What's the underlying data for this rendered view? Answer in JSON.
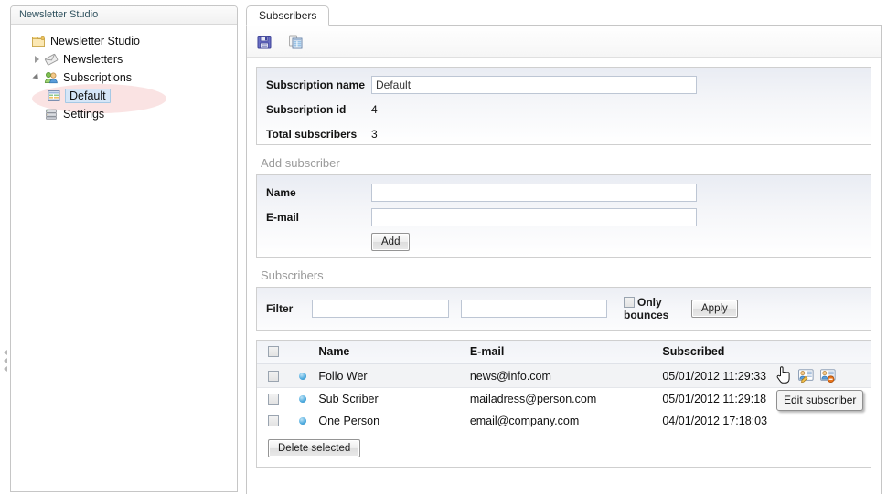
{
  "sidebar": {
    "header": "Newsletter Studio",
    "items": [
      {
        "label": "Newsletter Studio",
        "icon": "folder-icon",
        "level": 1,
        "expander": "none",
        "selected": false
      },
      {
        "label": "Newsletters",
        "icon": "newsletter-icon",
        "level": 2,
        "expander": "collapsed",
        "selected": false
      },
      {
        "label": "Subscriptions",
        "icon": "subscriptions-users-icon",
        "level": 2,
        "expander": "expanded",
        "selected": false
      },
      {
        "label": "Default",
        "icon": "subscription-list-icon",
        "level": 3,
        "expander": "none",
        "selected": true
      },
      {
        "label": "Settings",
        "icon": "settings-server-icon",
        "level": 2,
        "expander": "none",
        "selected": false
      }
    ]
  },
  "tabs": [
    {
      "label": "Subscribers",
      "active": true
    }
  ],
  "toolbar": {
    "save_icon": "save-floppy-icon",
    "export_icon": "export-table-icon"
  },
  "subscription": {
    "name_label": "Subscription name",
    "name_value": "Default",
    "name_placeholder": "",
    "id_label": "Subscription id",
    "id_value": "4",
    "total_label": "Total subscribers",
    "total_value": "3"
  },
  "add_subscriber": {
    "title": "Add subscriber",
    "name_label": "Name",
    "name_value": "",
    "name_placeholder": "",
    "email_label": "E-mail",
    "email_value": "",
    "email_placeholder": "",
    "add_button": "Add"
  },
  "subscribers_section": {
    "title": "Subscribers",
    "filter_label": "Filter",
    "filter_name_value": "",
    "filter_name_placeholder": "",
    "filter_email_value": "",
    "filter_email_placeholder": "",
    "only_bounces_label": "Only bounces",
    "only_bounces_checked": false,
    "apply_button": "Apply",
    "delete_selected_button": "Delete selected",
    "columns": [
      "",
      "",
      "Name",
      "E-mail",
      "Subscribed",
      ""
    ],
    "rows": [
      {
        "checked": false,
        "status_icon": "status-bullet-icon",
        "name": "Follo Wer",
        "email": "news@info.com",
        "subscribed": "05/01/2012 11:29:33",
        "hovered": true,
        "actions": [
          "edit-subscriber-icon",
          "delete-subscriber-icon"
        ]
      },
      {
        "checked": false,
        "status_icon": "status-bullet-icon",
        "name": "Sub Scriber",
        "email": "mailadress@person.com",
        "subscribed": "05/01/2012 11:29:18",
        "hovered": false,
        "actions": []
      },
      {
        "checked": false,
        "status_icon": "status-bullet-icon",
        "name": "One Person",
        "email": "email@company.com",
        "subscribed": "04/01/2012 17:18:03",
        "hovered": false,
        "actions": []
      }
    ]
  },
  "tooltip": {
    "text": "Edit subscriber"
  },
  "colors": {
    "panel_border": "#cfcfcf",
    "panel_gradient_top": "#e9ecf3",
    "accent_blue": "#49a8dd",
    "highlight_pink": "#f9dede",
    "selection_blue": "#d6e6f7",
    "section_title_grey": "#9a9a9a",
    "sidebar_header_text": "#30525f"
  }
}
